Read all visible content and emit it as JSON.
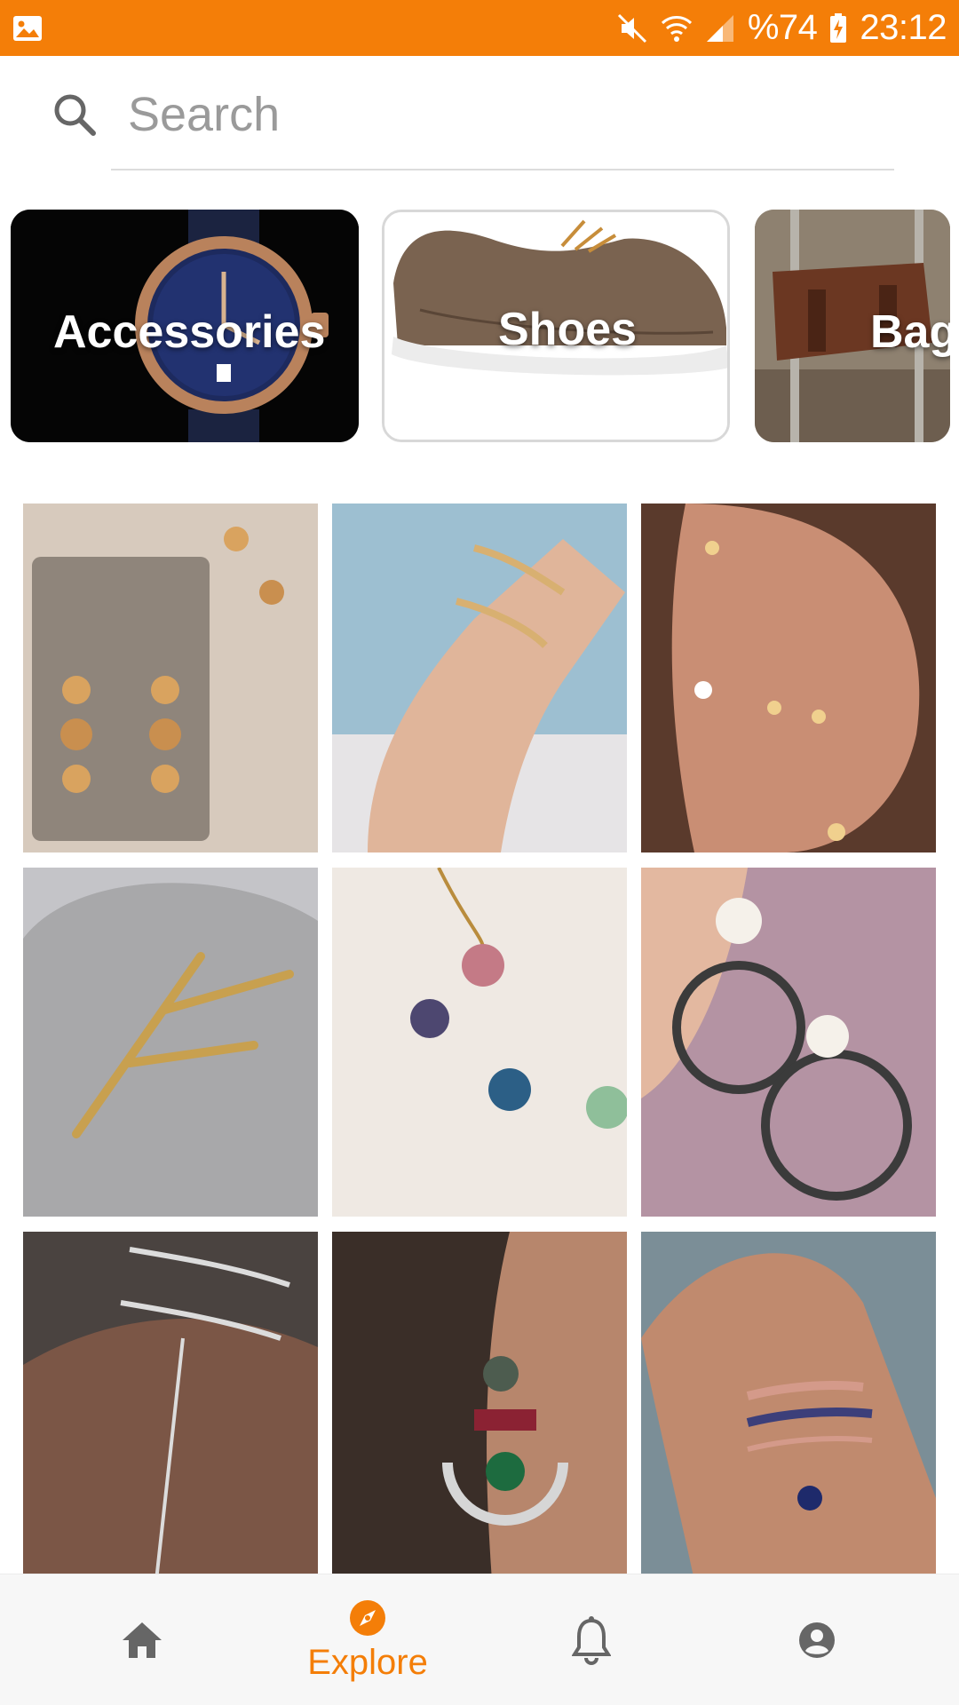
{
  "status_bar": {
    "battery": "%74",
    "time": "23:12"
  },
  "search": {
    "placeholder": "Search",
    "value": ""
  },
  "categories": [
    {
      "label": "Accessories"
    },
    {
      "label": "Shoes"
    },
    {
      "label": "Bag"
    }
  ],
  "grid": {
    "columns": 3,
    "item_count": 9
  },
  "bottom_nav": {
    "items": [
      {
        "id": "home",
        "label": "",
        "icon": "home-icon",
        "active": false
      },
      {
        "id": "explore",
        "label": "Explore",
        "icon": "compass-icon",
        "active": true
      },
      {
        "id": "notifications",
        "label": "",
        "icon": "bell-icon",
        "active": false
      },
      {
        "id": "profile",
        "label": "",
        "icon": "account-icon",
        "active": false
      }
    ]
  },
  "colors": {
    "accent": "#f47e08",
    "inactive_icon": "#666666"
  }
}
